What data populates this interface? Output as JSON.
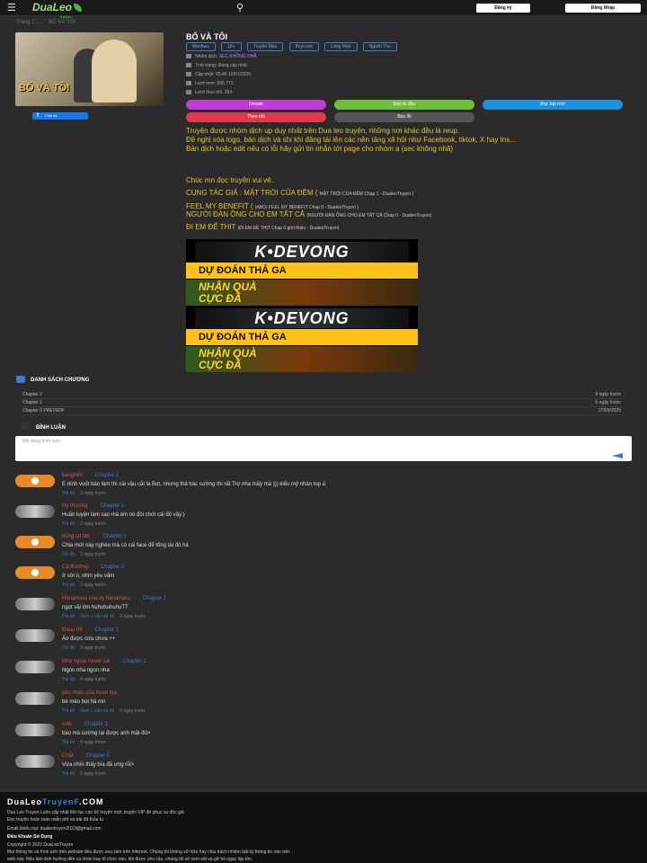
{
  "header": {
    "logo": "DuaLeo",
    "logo_sub": "Truyen",
    "register": "Đăng ký",
    "login": "Đăng Nhập"
  },
  "breadcrumb": [
    "Trang C...",
    "BỐ VÀ TÔI"
  ],
  "cover": {
    "title": "BỐ VÀ TÔI"
  },
  "share_label": "Chia sẻ",
  "manga": {
    "title": "BỐ VÀ TÔI",
    "tags": [
      "Manhwa",
      "18+",
      "Truyện Màu",
      "BoyLove",
      "Lãng Mạn",
      "Người Thú"
    ],
    "group_label": "Nhóm dịch:",
    "group": "SEC KHÔNG NHÃ",
    "status": "Tình trạng: Đang cập nhật",
    "updated": "Cập nhật: 05:46 10/01/2025",
    "views": "Lượt xem: 895,771",
    "follows": "Lượt theo dõi: 264"
  },
  "actions": {
    "donate": "Donate",
    "read_first": "Đọc từ đầu",
    "read_latest": "Đọc tập mới",
    "follow": "Theo dõi",
    "report": "Báo lỗi"
  },
  "description": [
    "Truyện được nhóm dịch up duy nhất trên Dua leo truyện, những nơi khác đều là reup.",
    "Đề nghị xóa logo, bản dịch và sfx khi đăng tải lên các nền tảng xã hội như Facebook, tiktok, X hay Ins...",
    "Bản dịch hoặc edit nếu có lỗi hãy gửi tin nhắn tới page cho nhóm ạ (sec không nhã)"
  ],
  "greeting": "Chúc mn đọc truyện vui vẻ.",
  "recommend": [
    {
      "title": "CUNG TÁC GIẢ : MẶT TRỜI CỦA ĐÊM (",
      "sub": "MẶT TRỜI CỦA ĐÊM Chap 1 - DualeoTruyen )"
    },
    {
      "title": "FEEL MY BENEFIT (",
      "sub": "(ABO) FEEL MY BENEFIT Chap 0 - DualeoTruyen )"
    },
    {
      "title": "NGƯỜI ĐÀN ÔNG CHO EM TẤT CẢ",
      "sub": "(NGƯỜI ĐÀN ÔNG CHO EM TẤT CẢ Chap 0 - DualeoTruyen)"
    },
    {
      "title": "ĐI EM ĐỂ THIT",
      "sub": "(ĐI EM ĐỂ THIT Chap 0 giới thiệu - DualeoTruyen)"
    }
  ],
  "ad": {
    "brand": "K•DEVONG",
    "line1": "DỰ ĐOÁN THẢ GA",
    "line2": "NHẬN QUÀ",
    "line3": "CỰC ĐÃ"
  },
  "chapters_title": "DANH SÁCH CHƯƠNG",
  "chapters": [
    {
      "name": "Chapter 2",
      "date": "9 ngày trước"
    },
    {
      "name": "Chapter 1",
      "date": "6 ngày trước"
    },
    {
      "name": "Chapter 0 PREVIEW",
      "date": "27/09/2025"
    }
  ],
  "comments_title": "BÌNH LUẬN",
  "comment_placeholder": "Nội dung bình luận",
  "comments": [
    {
      "user": "kangmhi",
      "chapter": "Chapter 2",
      "text": "E dính vuốt bảo làm thì cái vậu cắt là Bot, nhưng thả bác sướng thì rất Trợ nha mấy mà ))) kiểu mỹ nhân top á",
      "reply": "Trả lời",
      "time": "2 ngày trước",
      "avatar": "orange"
    },
    {
      "user": "Hy thương",
      "chapter": "Chapter 1",
      "text": "Huấn luyện làm sao mà em nó đòi chơi cái đó vậy:)",
      "reply": "Trả lời",
      "time": "2 ngày trước",
      "avatar": "photo"
    },
    {
      "user": "hùng có tên",
      "chapter": "Chapter 0",
      "text": "Chia mới này nghèo mà có cái face để tổng tài đó hả",
      "reply": "Trả lời",
      "time": "2 ngày trước",
      "avatar": "orange"
    },
    {
      "user": "Cá thường",
      "chapter": "Chapter 2",
      "text": "ở sởi ò, nhìn yêu vãm",
      "reply": "Trả lời",
      "time": "2 ngày trước",
      "avatar": "orange"
    },
    {
      "user": "Hanamaru của vy hanamaru",
      "chapter": "Chapter 1",
      "text": "ngọt vãi lờn huhuhuhuhuTT",
      "reply": "Trả lời",
      "extra": "Xem 1 câu trả lời",
      "time": "3 ngày trước",
      "avatar": "photo"
    },
    {
      "user": "Đàuu 09",
      "chapter": "Chapter 2",
      "text": "Áo được cứa chưa ++",
      "reply": "Trả lời",
      "time": "3 ngày trước",
      "avatar": "photo"
    },
    {
      "user": "Nhà ngoại never sai",
      "chapter": "Chapter 1",
      "text": "Ngon nha ngon nha",
      "reply": "Trả lời",
      "time": "4 ngày trước",
      "avatar": "photo"
    },
    {
      "user": "yêu nhân của hoàn bia",
      "chapter": "",
      "text": "bé mèo bọt hả mn",
      "reply": "Trả lời",
      "extra": "Xem 1 câu trả lời",
      "time": "5 ngày trước",
      "avatar": "photo"
    },
    {
      "user": "lonii",
      "chapter": "Chapter 1",
      "text": "bao mà sướng tại được anh mặt đó>",
      "reply": "Trả lời",
      "time": "5 ngày trước",
      "avatar": "photo"
    },
    {
      "user": "Chắt",
      "chapter": "Chapter 0",
      "text": "Vừa nhìn thấy bìa đã ưng rồi>",
      "reply": "Trả lời",
      "time": "5 ngày trước",
      "avatar": "photo"
    }
  ],
  "footer": {
    "brand1": "DuaLeo",
    "brand2": "TruyenF",
    "brand3": ".COM",
    "l1": "Dua Leo Truyen Luôn cập nhật liên tục các bộ truyện mới, truyện VIP để phục vụ độc giả",
    "l2": "Đọc truyện hoàn toàn miễn phí và trải đã thỏa tu",
    "l3": "Email khiếu nại: dualeotruyen2023@gmail.com",
    "l4": "Điều Khoản Sử Dụng",
    "l5": "Copyright © 2022 DuaLeoTruyen",
    "l6": "Mọi thông tin và hình ảnh trên website đều được sưu tầm trên Internet. Chúng tôi không sở hữu hay chịu trách nhiệm bất kỳ thông tin nào trên",
    "l7": "web này. Nếu làm ảnh hưởng đến cá nhân hay tổ chức nào, khi được yêu cầu, chúng tôi sẽ xem xét và gỡ bỏ ngay lập tức."
  },
  "colors": {
    "accent": "#3a7bd5",
    "desc": "#e6c02e",
    "donate": "#c13bd6",
    "read_first": "#6fbf3a",
    "read_latest": "#1e90e0",
    "follow": "#e0384c",
    "report": "#555555"
  }
}
